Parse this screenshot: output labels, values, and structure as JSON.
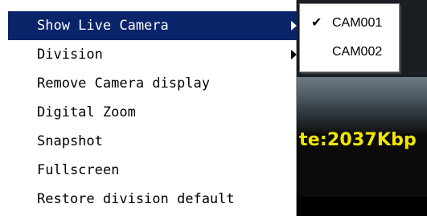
{
  "video": {
    "overlay_text": "te:2037Kbp"
  },
  "context_menu": {
    "items": [
      {
        "label": "Show Live Camera",
        "has_submenu": true,
        "highlighted": true
      },
      {
        "label": "Division",
        "has_submenu": true,
        "highlighted": false
      },
      {
        "label": "Remove Camera display",
        "has_submenu": false,
        "highlighted": false
      },
      {
        "label": "Digital Zoom",
        "has_submenu": false,
        "highlighted": false
      },
      {
        "label": "Snapshot",
        "has_submenu": false,
        "highlighted": false
      },
      {
        "label": "Fullscreen",
        "has_submenu": false,
        "highlighted": false
      },
      {
        "label": "Restore division default",
        "has_submenu": false,
        "highlighted": false
      }
    ]
  },
  "submenu": {
    "items": [
      {
        "label": "CAM001",
        "checked": true,
        "check_glyph": "✔"
      },
      {
        "label": "CAM002",
        "checked": false,
        "check_glyph": ""
      }
    ]
  },
  "colors": {
    "highlight": "#0a246a",
    "overlay_text": "#f2e600"
  }
}
